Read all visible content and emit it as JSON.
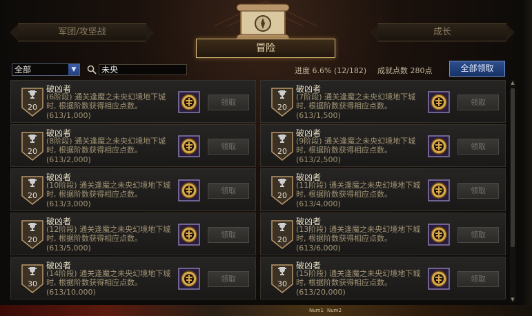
{
  "tabs": {
    "left": "军团/攻坚战",
    "center": "冒险",
    "right": "成长"
  },
  "filter": {
    "category_selected": "全部",
    "search_value": "未央"
  },
  "stats": {
    "progress": "进度 6.6% (12/182)",
    "points": "成就点数 280点"
  },
  "claim_all_label": "全部领取",
  "achievements": [
    {
      "title": "破凶者",
      "desc": "(6阶段) 通关逢魔之未央幻境地下城时, 根据阶数获得相应点数。",
      "count": "(613/1,000)",
      "shield": "20",
      "button": "领取"
    },
    {
      "title": "破凶者",
      "desc": "(7阶段) 通关逢魔之未央幻境地下城时, 根据阶数获得相应点数。",
      "count": "(613/1,500)",
      "shield": "20",
      "button": "领取"
    },
    {
      "title": "破凶者",
      "desc": "(8阶段) 通关逢魔之未央幻境地下城时, 根据阶数获得相应点数。",
      "count": "(613/2,000)",
      "shield": "20",
      "button": "领取"
    },
    {
      "title": "破凶者",
      "desc": "(9阶段) 通关逢魔之未央幻境地下城时, 根据阶数获得相应点数。",
      "count": "(613/2,500)",
      "shield": "20",
      "button": "领取"
    },
    {
      "title": "破凶者",
      "desc": "(10阶段) 通关逢魔之未央幻境地下城时, 根据阶数获得相应点数。",
      "count": "(613/3,000)",
      "shield": "20",
      "button": "领取"
    },
    {
      "title": "破凶者",
      "desc": "(11阶段) 通关逢魔之未央幻境地下城时, 根据阶数获得相应点数。",
      "count": "(613/4,000)",
      "shield": "20",
      "button": "领取"
    },
    {
      "title": "破凶者",
      "desc": "(12阶段) 通关逢魔之未央幻境地下城时, 根据阶数获得相应点数。",
      "count": "(613/5,000)",
      "shield": "20",
      "button": "领取"
    },
    {
      "title": "破凶者",
      "desc": "(13阶段) 通关逢魔之未央幻境地下城时, 根据阶数获得相应点数。",
      "count": "(613/6,000)",
      "shield": "20",
      "button": "领取"
    },
    {
      "title": "破凶者",
      "desc": "(14阶段) 通关逢魔之未央幻境地下城时, 根据阶数获得相应点数。",
      "count": "(613/10,000)",
      "shield": "30",
      "button": "领取"
    },
    {
      "title": "破凶者",
      "desc": "(15阶段) 通关逢魔之未央幻境地下城时, 根据阶数获得相应点数。",
      "count": "(613/20,000)",
      "shield": "30",
      "button": "领取"
    }
  ],
  "taskbar": {
    "labels": [
      "Num1",
      "Num2"
    ]
  },
  "colors": {
    "accent_gold": "#d9b877",
    "claim_all_blue": "#2e4f8e"
  }
}
